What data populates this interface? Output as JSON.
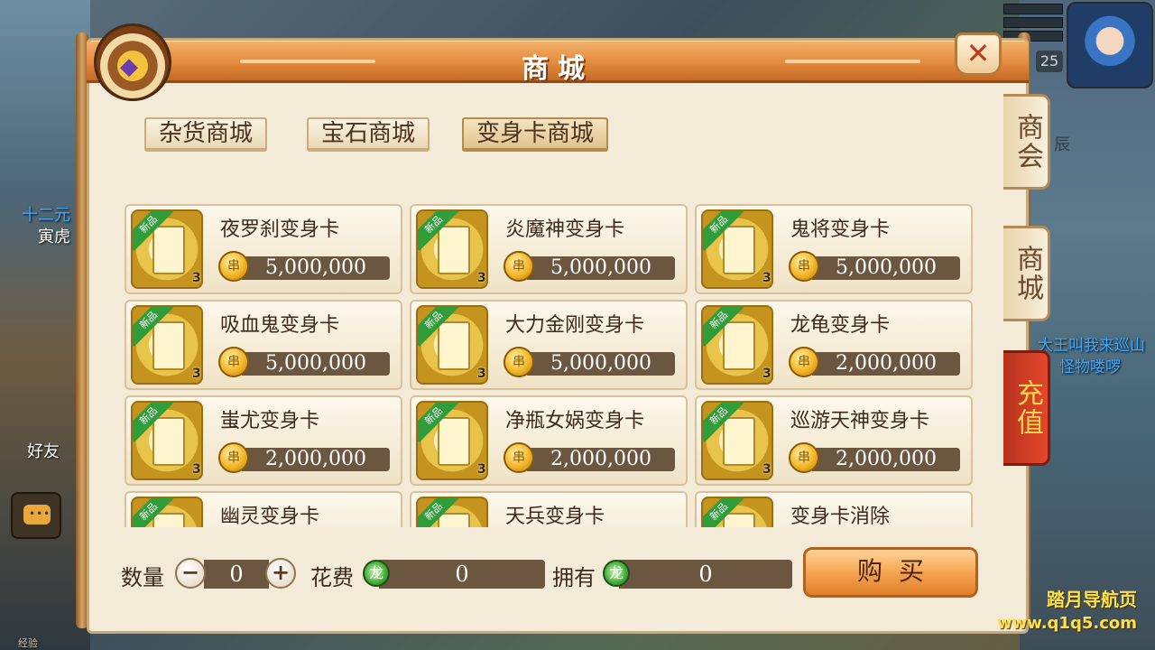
{
  "title": "商城",
  "close_glyph": "✕",
  "chest_glyph": "◆",
  "sub_tabs": [
    {
      "label": "杂货商城",
      "active": false
    },
    {
      "label": "宝石商城",
      "active": false
    },
    {
      "label": "变身卡商城",
      "active": true
    }
  ],
  "side_tabs": [
    {
      "label": "商会"
    },
    {
      "label": "商城"
    },
    {
      "label": "充值"
    }
  ],
  "item_badge": "新品",
  "items": [
    {
      "name": "夜罗刹变身卡",
      "count": "3",
      "price": "5,000,000"
    },
    {
      "name": "炎魔神变身卡",
      "count": "3",
      "price": "5,000,000"
    },
    {
      "name": "鬼将变身卡",
      "count": "3",
      "price": "5,000,000"
    },
    {
      "name": "吸血鬼变身卡",
      "count": "3",
      "price": "5,000,000"
    },
    {
      "name": "大力金刚变身卡",
      "count": "3",
      "price": "5,000,000"
    },
    {
      "name": "龙龟变身卡",
      "count": "3",
      "price": "2,000,000"
    },
    {
      "name": "蚩尤变身卡",
      "count": "3",
      "price": "2,000,000"
    },
    {
      "name": "净瓶女娲变身卡",
      "count": "3",
      "price": "2,000,000"
    },
    {
      "name": "巡游天神变身卡",
      "count": "3",
      "price": "2,000,000"
    },
    {
      "name": "幽灵变身卡",
      "count": "",
      "price": ""
    },
    {
      "name": "天兵变身卡",
      "count": "",
      "price": ""
    },
    {
      "name": "变身卡消除",
      "count": "",
      "price": ""
    }
  ],
  "coin_glyph": "串",
  "bottom": {
    "quantity_label": "数量",
    "quantity_value": "0",
    "minus_glyph": "−",
    "plus_glyph": "+",
    "cost_label": "花费",
    "cost_value": "0",
    "owned_label": "拥有",
    "owned_value": "0",
    "currency_glyph": "龙",
    "buy_label": "购买"
  },
  "background": {
    "left_labels": [
      "十二元",
      "寅虎",
      "好友"
    ],
    "right_labels": [
      "辰",
      "大王叫我来巡山",
      "怪物喽啰"
    ],
    "level": "25",
    "exp_label": "经验"
  },
  "watermark": {
    "line1": "踏月导航页",
    "line2": "www.q1q5.com"
  }
}
